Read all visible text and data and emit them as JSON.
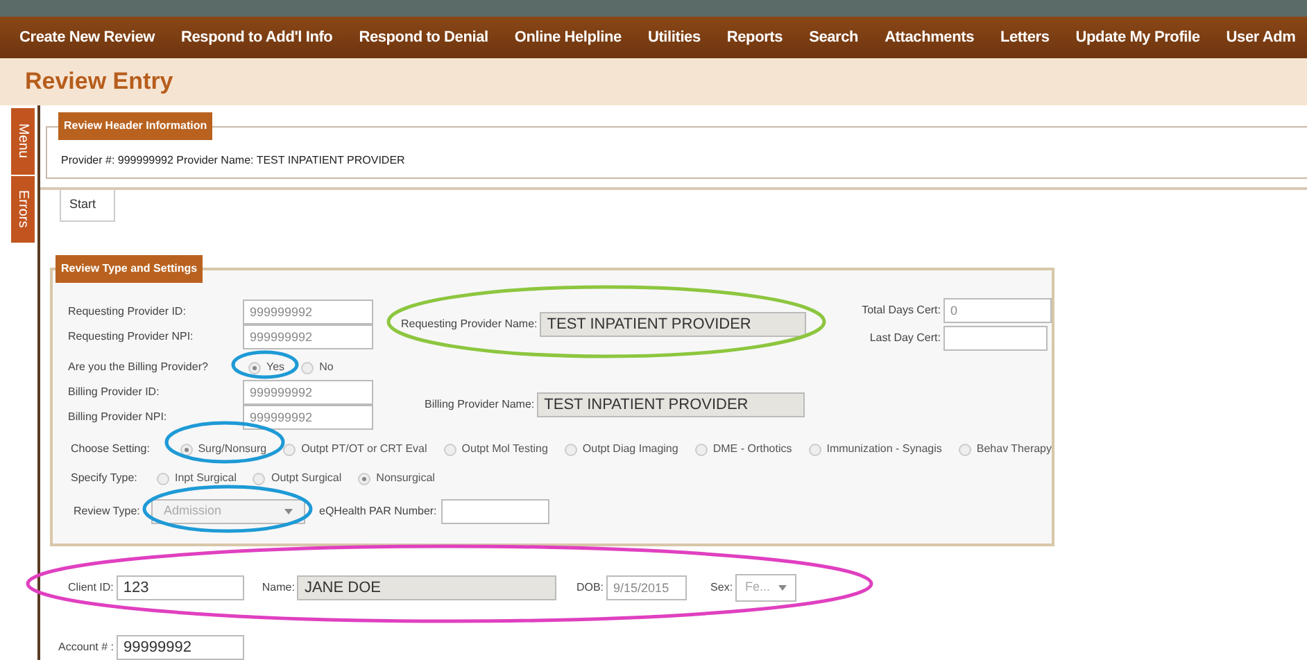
{
  "nav": [
    "Create New Review",
    "Respond to Add'l Info",
    "Respond to Denial",
    "Online Helpline",
    "Utilities",
    "Reports",
    "Search",
    "Attachments",
    "Letters",
    "Update My Profile",
    "User Adm"
  ],
  "page_title": "Review Entry",
  "side_tabs": [
    "Menu",
    "Errors"
  ],
  "header": {
    "legend": "Review Header Information",
    "text": "Provider #: 999999992 Provider Name: TEST INPATIENT PROVIDER"
  },
  "tabs": [
    {
      "label": "Start",
      "selected": true
    }
  ],
  "settings": {
    "legend": "Review Type and Settings",
    "requesting": {
      "id_label": "Requesting Provider ID:",
      "id_value": "999999992",
      "npi_label": "Requesting Provider NPI:",
      "npi_value": "999999992",
      "name_label": "Requesting Provider Name:",
      "name_value": "TEST INPATIENT PROVIDER"
    },
    "total_days_cert": {
      "label": "Total Days Cert:",
      "value": "0"
    },
    "last_day_cert": {
      "label": "Last Day Cert:"
    },
    "billing_question": {
      "label": "Are you the Billing Provider?",
      "options": [
        {
          "label": "Yes",
          "selected": true
        },
        {
          "label": "No",
          "selected": false
        }
      ]
    },
    "billing": {
      "id_label": "Billing Provider ID:",
      "id_value": "999999992",
      "npi_label": "Billing Provider NPI:",
      "npi_value": "999999992",
      "name_label": "Billing Provider Name:",
      "name_value": "TEST INPATIENT PROVIDER"
    },
    "setting": {
      "label": "Choose Setting:",
      "options": [
        {
          "label": "Surg/Nonsurg",
          "selected": true
        },
        {
          "label": "Outpt PT/OT or CRT Eval",
          "selected": false
        },
        {
          "label": "Outpt Mol Testing",
          "selected": false
        },
        {
          "label": "Outpt Diag Imaging",
          "selected": false
        },
        {
          "label": "DME - Orthotics",
          "selected": false
        },
        {
          "label": "Immunization - Synagis",
          "selected": false
        },
        {
          "label": "Behav Therapy",
          "selected": false
        }
      ]
    },
    "specify_type": {
      "label": "Specify Type:",
      "options": [
        {
          "label": "Inpt Surgical",
          "selected": false
        },
        {
          "label": "Outpt Surgical",
          "selected": false
        },
        {
          "label": "Nonsurgical",
          "selected": true
        }
      ]
    },
    "review_type": {
      "label": "Review Type:",
      "value": "Admission"
    },
    "par_number": {
      "label": "eQHealth PAR Number:"
    }
  },
  "client": {
    "id_label": "Client ID:",
    "id_value": "123",
    "name_label": "Name:",
    "name_value": "JANE DOE",
    "dob_label": "DOB:",
    "dob_value": "9/15/2015",
    "sex_label": "Sex:",
    "sex_value": "Fe..."
  },
  "account": {
    "label": "Account # :",
    "value": "99999992"
  },
  "annotations": [
    {
      "color": "#8dc63f"
    },
    {
      "color": "#1e9ad6"
    },
    {
      "color": "#1e9ad6"
    },
    {
      "color": "#1e9ad6"
    },
    {
      "color": "#e040c0"
    }
  ]
}
